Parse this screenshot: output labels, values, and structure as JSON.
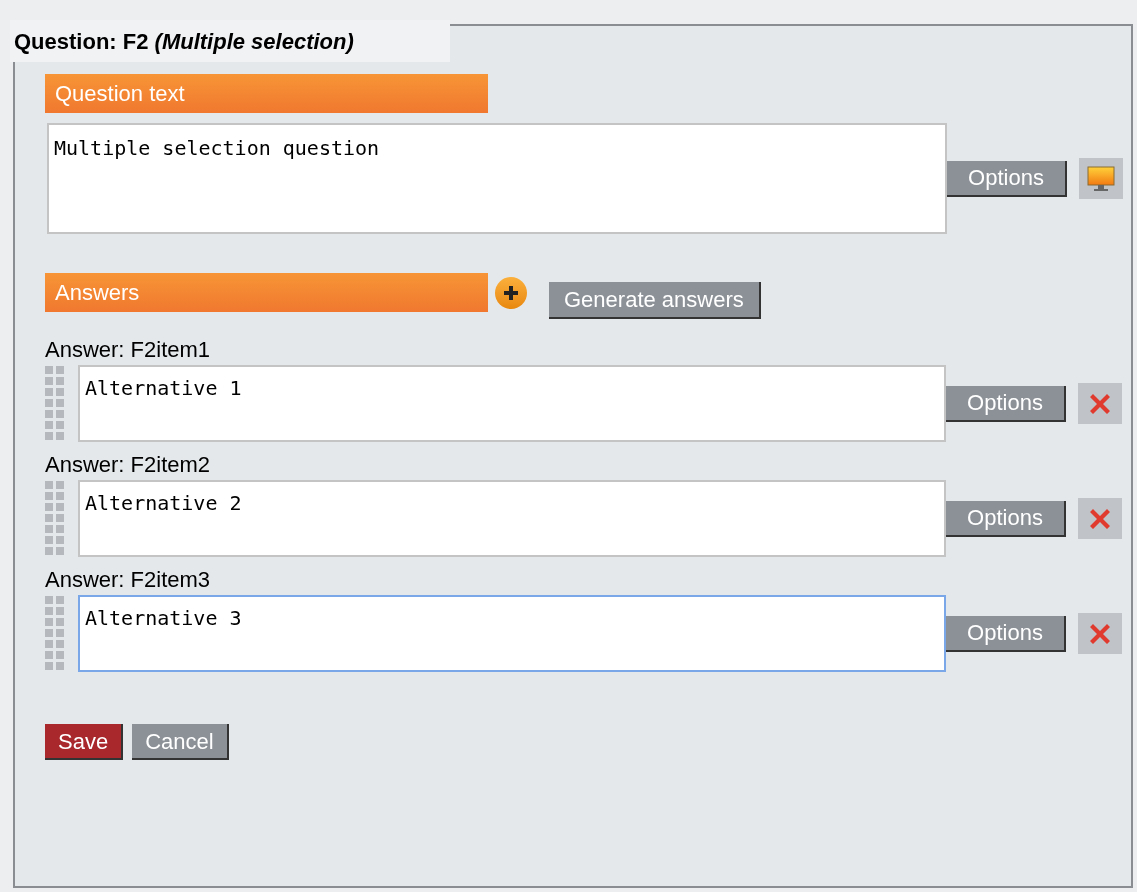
{
  "legend": "Question: F2 *(Multiple selection)*",
  "question_section": {
    "heading": "Question text",
    "value": "Multiple selection question",
    "options_button": "Options"
  },
  "answers_section": {
    "heading": "Answers",
    "generate_button": "Generate answers"
  },
  "answers": [
    {
      "label": "Answer: F2item1",
      "value": "Alternative 1",
      "options_button": "Options",
      "focused": false
    },
    {
      "label": "Answer: F2item2",
      "value": "Alternative 2",
      "options_button": "Options",
      "focused": false
    },
    {
      "label": "Answer: F2item3",
      "value": "Alternative 3",
      "options_button": "Options",
      "focused": true
    }
  ],
  "buttons": [
    {
      "label": "Save",
      "kind": "primary"
    },
    {
      "label": "Cancel",
      "kind": "secondary"
    }
  ]
}
